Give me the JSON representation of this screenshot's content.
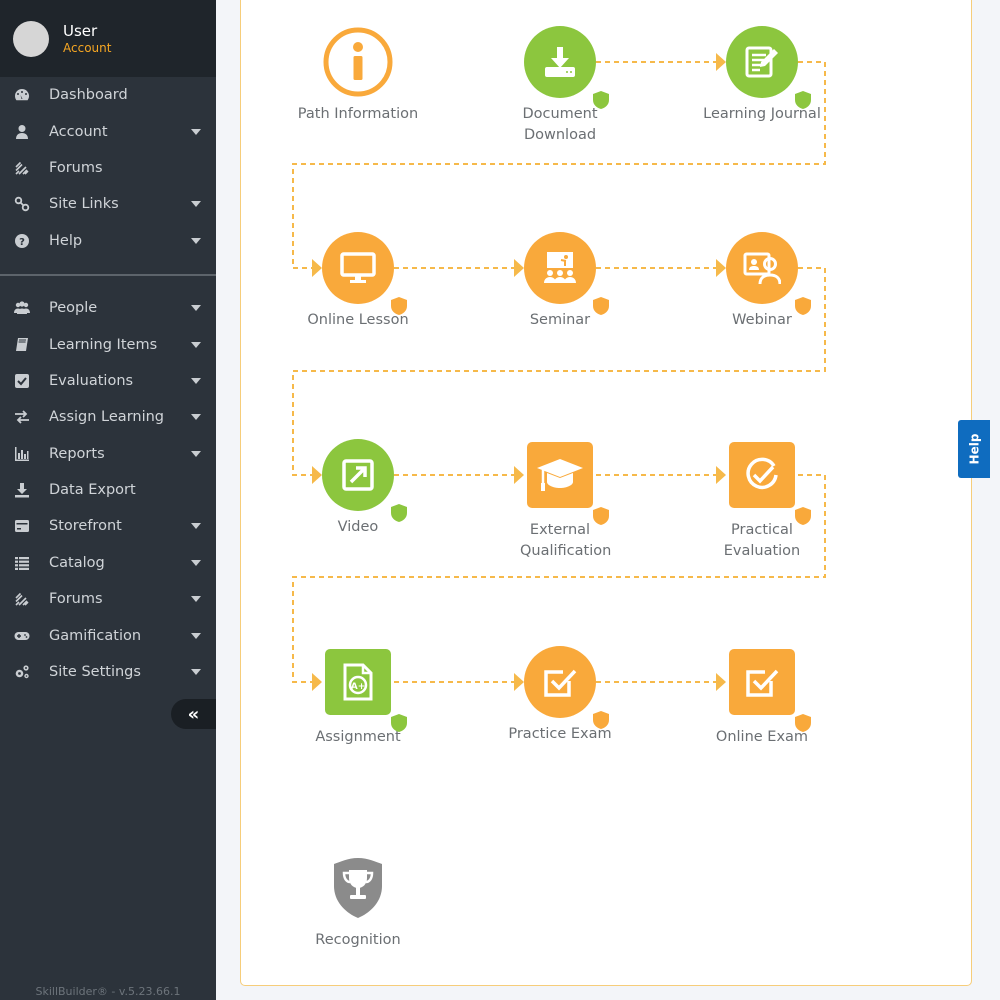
{
  "user": {
    "name": "User",
    "role": "Account"
  },
  "sidebar": {
    "primary": [
      {
        "label": "Dashboard",
        "icon": "dashboard-icon",
        "has_caret": false
      },
      {
        "label": "Account",
        "icon": "user-icon",
        "has_caret": true
      },
      {
        "label": "Forums",
        "icon": "forums-icon",
        "has_caret": false
      },
      {
        "label": "Site Links",
        "icon": "link-icon",
        "has_caret": true
      },
      {
        "label": "Help",
        "icon": "question-icon",
        "has_caret": true
      }
    ],
    "admin": [
      {
        "label": "People",
        "icon": "people-icon",
        "has_caret": true
      },
      {
        "label": "Learning Items",
        "icon": "book-icon",
        "has_caret": true
      },
      {
        "label": "Evaluations",
        "icon": "checkbox-icon",
        "has_caret": true
      },
      {
        "label": "Assign Learning",
        "icon": "exchange-icon",
        "has_caret": true
      },
      {
        "label": "Reports",
        "icon": "bar-chart-icon",
        "has_caret": true
      },
      {
        "label": "Data Export",
        "icon": "download-icon",
        "has_caret": false
      },
      {
        "label": "Storefront",
        "icon": "credit-card-icon",
        "has_caret": true
      },
      {
        "label": "Catalog",
        "icon": "list-icon",
        "has_caret": true
      },
      {
        "label": "Forums",
        "icon": "forums-icon",
        "has_caret": true
      },
      {
        "label": "Gamification",
        "icon": "gamepad-icon",
        "has_caret": true
      },
      {
        "label": "Site Settings",
        "icon": "cogs-icon",
        "has_caret": true
      }
    ],
    "collapse_label": "«",
    "version": "SkillBuilder® - v.5.23.66.1"
  },
  "help_tab": {
    "label": "Help"
  },
  "colors": {
    "orange": "#f9a93b",
    "green": "#8cc63e",
    "gray": "#8b8b8b",
    "connector": "#f6b94a",
    "help_blue": "#0f6cbf"
  },
  "learning_path": {
    "nodes": [
      {
        "label": "Path Information",
        "icon": "info-icon",
        "shape": "ring",
        "color": "orange",
        "shield": false
      },
      {
        "label": "Document Download",
        "icon": "download-icon",
        "shape": "circle",
        "color": "green",
        "shield": true
      },
      {
        "label": "Learning Journal",
        "icon": "journal-edit-icon",
        "shape": "circle",
        "color": "green",
        "shield": true
      },
      {
        "label": "Online Lesson",
        "icon": "monitor-icon",
        "shape": "circle",
        "color": "orange",
        "shield": true
      },
      {
        "label": "Seminar",
        "icon": "presentation-icon",
        "shape": "circle",
        "color": "orange",
        "shield": true
      },
      {
        "label": "Webinar",
        "icon": "webinar-icon",
        "shape": "circle",
        "color": "orange",
        "shield": true
      },
      {
        "label": "Video",
        "icon": "external-link-icon",
        "shape": "circle",
        "color": "green",
        "shield": true
      },
      {
        "label": "External Qualification",
        "icon": "graduation-cap-icon",
        "shape": "square",
        "color": "orange",
        "shield": true
      },
      {
        "label": "Practical Evaluation",
        "icon": "check-circle-icon",
        "shape": "square",
        "color": "orange",
        "shield": true
      },
      {
        "label": "Assignment",
        "icon": "graded-document-icon",
        "shape": "square",
        "color": "green",
        "shield": true
      },
      {
        "label": "Practice Exam",
        "icon": "check-square-icon",
        "shape": "circle",
        "color": "orange",
        "shield": true
      },
      {
        "label": "Online Exam",
        "icon": "check-square-icon",
        "shape": "square",
        "color": "orange",
        "shield": true
      },
      {
        "label": "Recognition",
        "icon": "trophy-shield-icon",
        "shape": "trophy",
        "color": "gray",
        "shield": false
      }
    ]
  }
}
